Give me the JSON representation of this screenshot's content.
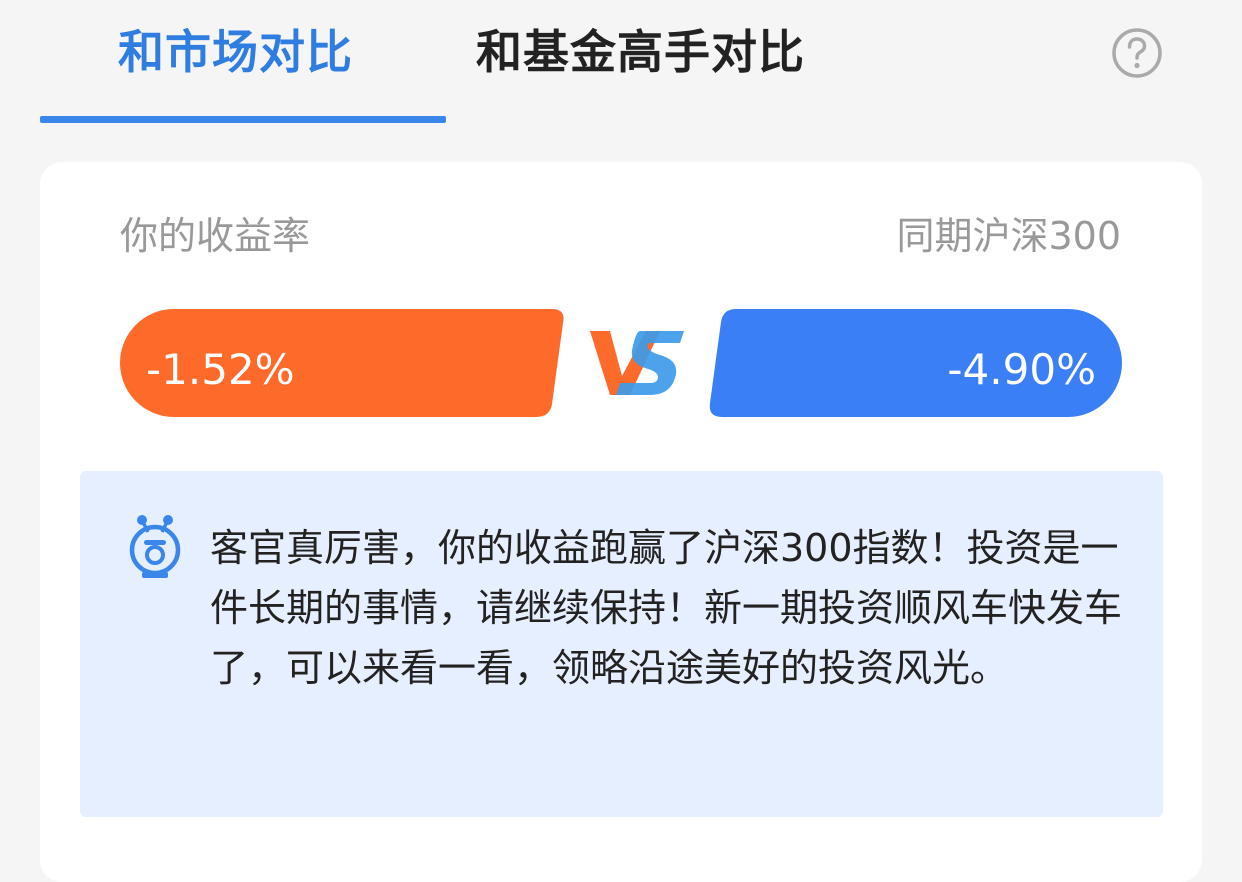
{
  "tabs": {
    "market": "和市场对比",
    "expert": "和基金高手对比"
  },
  "icons": {
    "help": "help-circle-icon",
    "vs": "vs-icon",
    "robot": "robot-assistant-icon"
  },
  "comparison": {
    "your_label": "你的收益率",
    "index_label": "同期沪深300",
    "your_value": "-1.52%",
    "index_value": "-4.90%",
    "your_color": "#fe6a2a",
    "index_color": "#3a7ff6"
  },
  "tip": {
    "text": "客官真厉害，你的收益跑赢了沪深300指数！投资是一件长期的事情，请继续保持！新一期投资顺风车快发车了，可以来看一看，领略沿途美好的投资风光。"
  },
  "colors": {
    "accent": "#2f7de1",
    "tip_bg": "#e6efff"
  }
}
